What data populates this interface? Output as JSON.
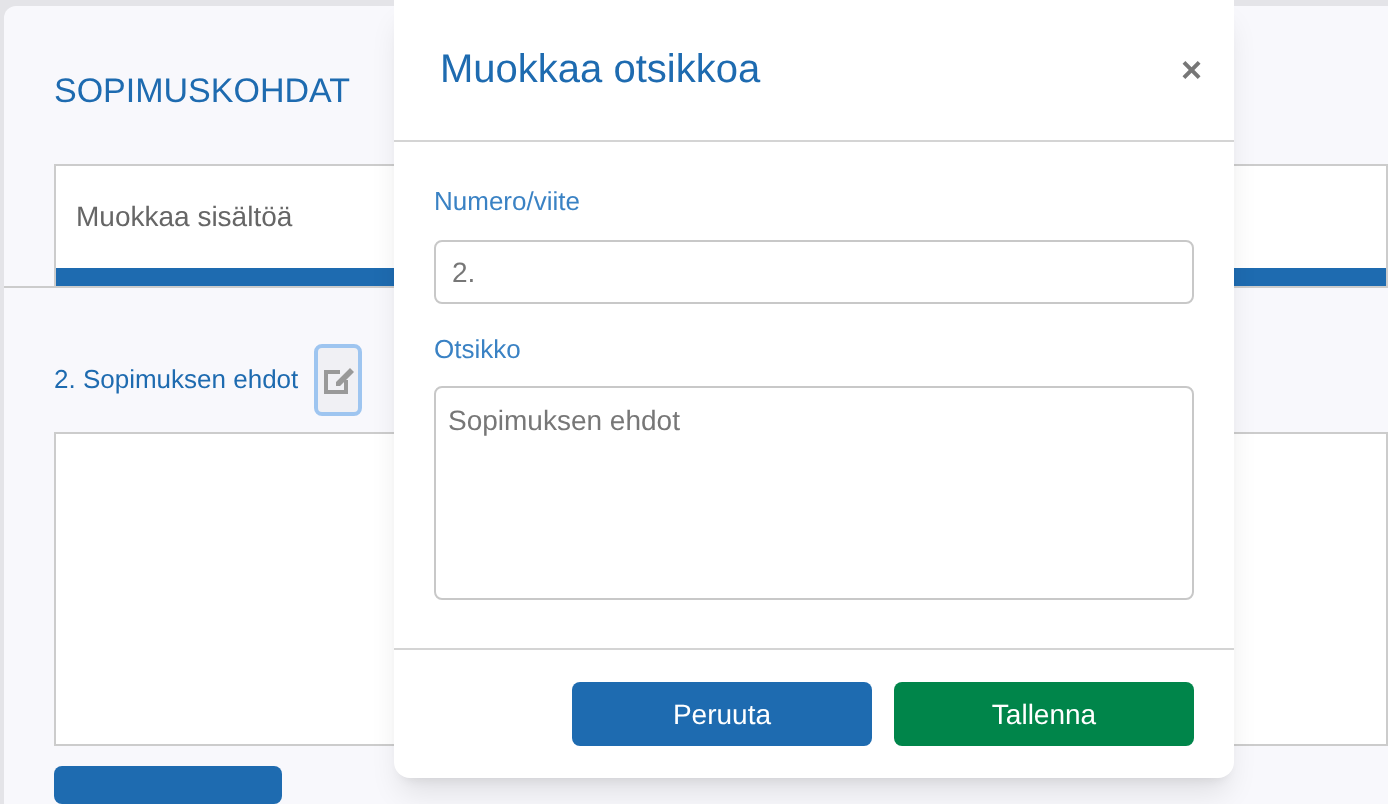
{
  "page": {
    "title": "SOPIMUSKOHDAT",
    "tab": {
      "label": "Muokkaa sisältöä",
      "selected": true
    },
    "section_heading": "2. Sopimuksen ehdot"
  },
  "dialog": {
    "title": "Muokkaa otsikkoa",
    "close": "×",
    "fields": [
      {
        "kind": "input",
        "label": "Numero/viite",
        "value": "2."
      },
      {
        "kind": "textarea",
        "label": "Otsikko",
        "value": "Sopimuksen ehdot"
      }
    ],
    "buttons": [
      {
        "kind": "secondary",
        "label": "Peruuta"
      },
      {
        "kind": "primary",
        "label": "Tallenna"
      }
    ]
  }
}
